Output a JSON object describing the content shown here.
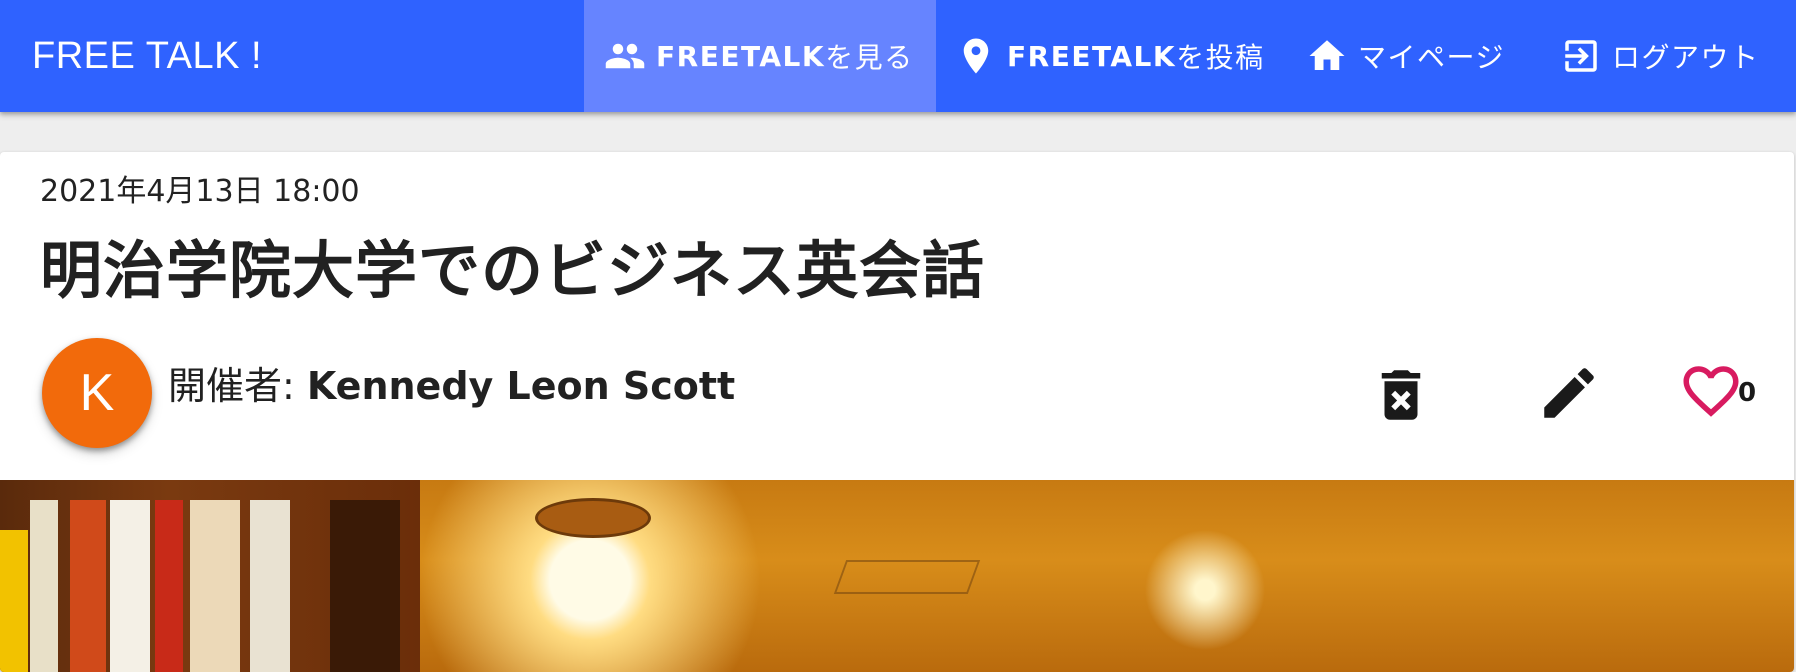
{
  "appbar": {
    "brand": "FREE TALK !",
    "nav": [
      {
        "id": "view",
        "label_bold": "FREETALK",
        "label_rest": "を見る",
        "icon": "group-icon",
        "active": true
      },
      {
        "id": "post",
        "label_bold": "FREETALK",
        "label_rest": "を投稿",
        "icon": "map-pin-icon",
        "active": false
      },
      {
        "id": "mypage",
        "label_bold": "",
        "label_rest": "マイページ",
        "icon": "home-icon",
        "active": false
      },
      {
        "id": "logout",
        "label_bold": "",
        "label_rest": "ログアウト",
        "icon": "logout-icon",
        "active": false
      }
    ],
    "colors": {
      "bar": "#2f62ff",
      "active": "#6684ff"
    }
  },
  "event": {
    "date": "2021年4月13日 18:00",
    "title": "明治学院大学でのビジネス英会話",
    "organizer_label": "開催者: ",
    "organizer_name": "Kennedy Leon Scott",
    "avatar_initial": "K",
    "avatar_color": "#f26a0b",
    "like_count": "0",
    "like_color": "#d81b60"
  },
  "actions": {
    "delete_icon": "delete-forever-icon",
    "edit_icon": "pencil-icon",
    "like_icon": "heart-outline-icon"
  }
}
